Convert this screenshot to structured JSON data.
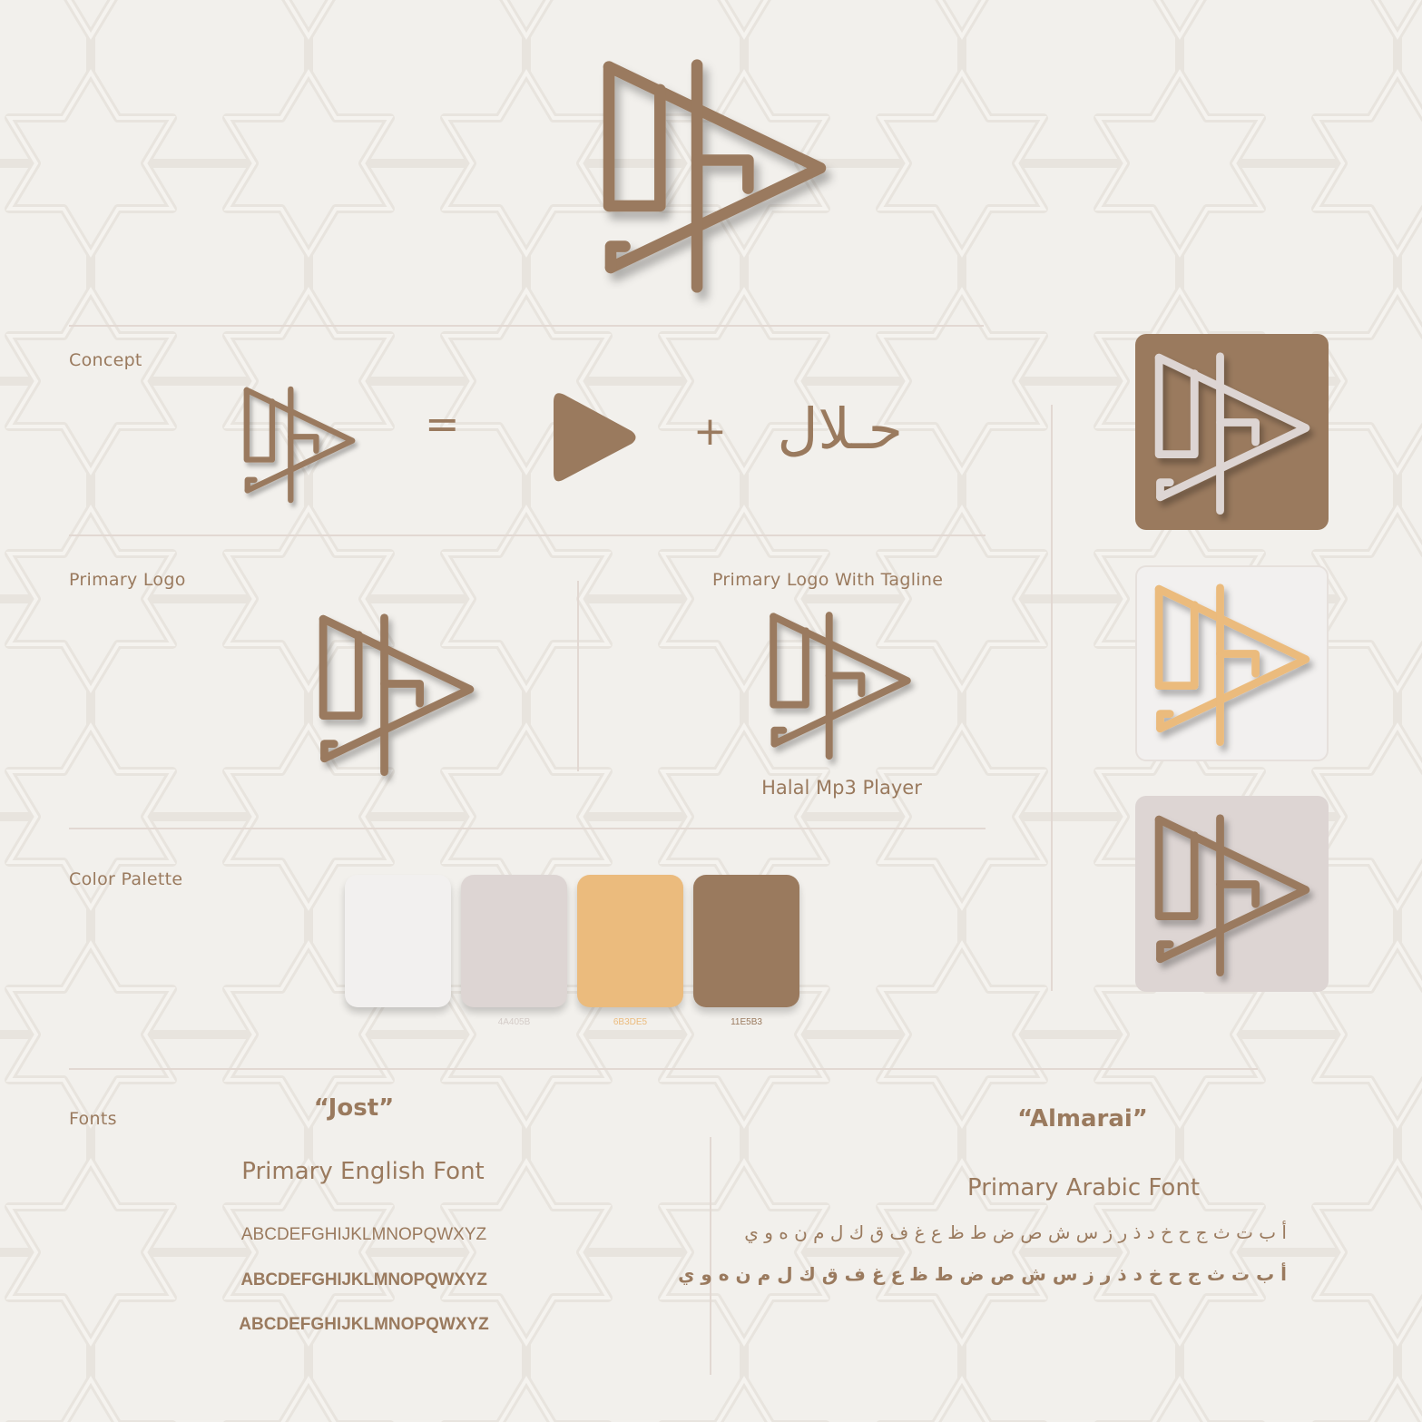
{
  "sections": {
    "concept": "Concept",
    "primary_logo": "Primary Logo",
    "primary_logo_tagline": "Primary Logo With Tagline",
    "color_palette": "Color Palette",
    "fonts": "Fonts"
  },
  "concept": {
    "equals": "=",
    "plus": "+",
    "arabic_word": "حـلال"
  },
  "tagline": "Halal Mp3 Player",
  "colors": {
    "brown": "#9a7a5e",
    "taupe": "#ddd5d3",
    "gold": "#ebbb7d",
    "white": "#f2f0ef"
  },
  "palette": [
    {
      "color": "#f2f0ef",
      "code": ""
    },
    {
      "color": "#ddd5d3",
      "code": "4A405B"
    },
    {
      "color": "#ebbb7d",
      "code": "6B3DE5"
    },
    {
      "color": "#9a7a5e",
      "code": "11E5B3"
    }
  ],
  "fonts": {
    "english": {
      "name": "“Jost”",
      "role": "Primary English Font",
      "samples": [
        "ABCDEFGHIJKLMNOPQWXYZ",
        "ABCDEFGHIJKLMNOPQWXYZ",
        "ABCDEFGHIJKLMNOPQWXYZ"
      ]
    },
    "arabic": {
      "name": "“Almarai”",
      "role": "Primary Arabic Font",
      "samples": [
        "أ ب ت ث ج ح خ د ذ ر ز س ش ص ض ط ظ ع غ ف ق ك ل م ن ه و ي",
        "أ ب ت ث ج ح خ د ذ ر ز س ش ص ض ط ظ ع غ ف ق ك ل م ن ه و ي"
      ]
    }
  }
}
